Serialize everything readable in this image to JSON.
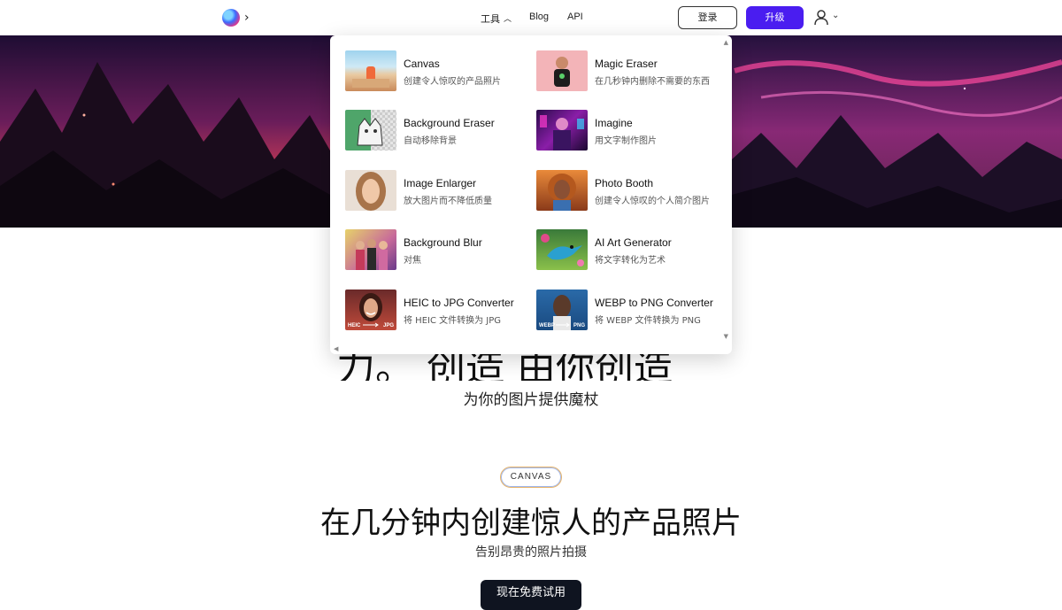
{
  "header": {
    "nav": {
      "tools": "工具",
      "blog": "Blog",
      "api": "API"
    },
    "login": "登录",
    "upgrade": "升级"
  },
  "tools_menu": {
    "items": [
      {
        "name": "Canvas",
        "desc": "创建令人惊叹的产品照片"
      },
      {
        "name": "Magic Eraser",
        "desc": "在几秒钟内删除不需要的东西"
      },
      {
        "name": "Background Eraser",
        "desc": "自动移除背景"
      },
      {
        "name": "Imagine",
        "desc": "用文字制作图片"
      },
      {
        "name": "Image Enlarger",
        "desc": "放大图片而不降低质量"
      },
      {
        "name": "Photo Booth",
        "desc": "创建令人惊叹的个人简介图片"
      },
      {
        "name": "Background Blur",
        "desc": "对焦"
      },
      {
        "name": "AI Art Generator",
        "desc": "将文字转化为艺术"
      },
      {
        "name": "HEIC to JPG Converter",
        "desc": "将 HEIC 文件转换为 JPG",
        "thumb_labels": [
          "HEIC",
          "JPG"
        ]
      },
      {
        "name": "WEBP to PNG Converter",
        "desc": "将 WEBP 文件转换为 PNG",
        "thumb_labels": [
          "WEBP",
          "PNG"
        ]
      }
    ]
  },
  "hero": {
    "headline_partial": "力。 创造 由你创造",
    "subtitle": "为你的图片提供魔杖"
  },
  "canvas_section": {
    "pill": "CANVAS",
    "title": "在几分钟内创建惊人的产品照片",
    "subtitle": "告别昂贵的照片拍摄",
    "cta": "现在免费试用"
  },
  "colors": {
    "upgrade_button": "#4a1df0",
    "cta_button": "#0f1420"
  }
}
